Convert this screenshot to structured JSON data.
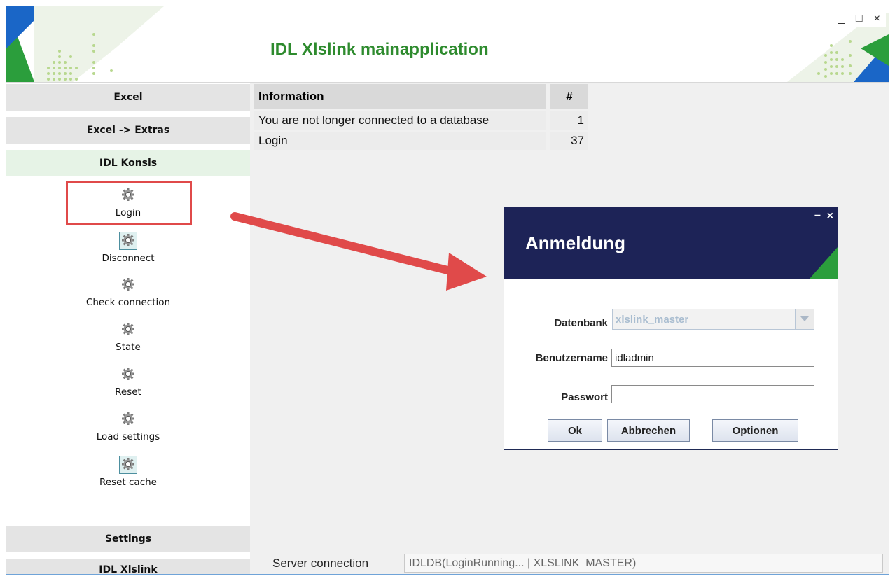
{
  "app": {
    "title": "IDL Xlslink mainapplication",
    "controls": {
      "minimize": "_",
      "maximize": "□",
      "close": "×"
    }
  },
  "sidebar": {
    "sections": [
      "Excel",
      "Excel -> Extras",
      "IDL Konsis",
      "Settings",
      "IDL Xlslink"
    ],
    "active_section": "IDL Konsis",
    "items": [
      {
        "label": "Login",
        "icon": "gear-icon"
      },
      {
        "label": "Disconnect",
        "icon": "gear-icon"
      },
      {
        "label": "Check connection",
        "icon": "gear-icon"
      },
      {
        "label": "State",
        "icon": "gear-icon"
      },
      {
        "label": "Reset",
        "icon": "gear-icon"
      },
      {
        "label": "Load settings",
        "icon": "gear-icon"
      },
      {
        "label": "Reset cache",
        "icon": "gear-icon"
      }
    ]
  },
  "info_table": {
    "headers": [
      "Information",
      "#"
    ],
    "rows": [
      {
        "info": "You are not longer connected to a database",
        "count": "1"
      },
      {
        "info": "Login",
        "count": "37"
      }
    ]
  },
  "dialog": {
    "title": "Anmeldung",
    "controls": {
      "minimize": "−",
      "close": "×"
    },
    "fields": {
      "datenbank_label": "Datenbank",
      "datenbank_value": "xlslink_master",
      "benutzername_label": "Benutzername",
      "benutzername_value": "idladmin",
      "passwort_label": "Passwort",
      "passwort_value": ""
    },
    "buttons": {
      "ok": "Ok",
      "cancel": "Abbrechen",
      "options": "Optionen"
    }
  },
  "status": {
    "label": "Server connection",
    "value": "IDLDB(LoginRunning... | XLSLINK_MASTER)"
  },
  "colors": {
    "accent_green": "#2e8b2e",
    "dialog_header": "#1d2357",
    "annotation_red": "#e04a4a"
  }
}
